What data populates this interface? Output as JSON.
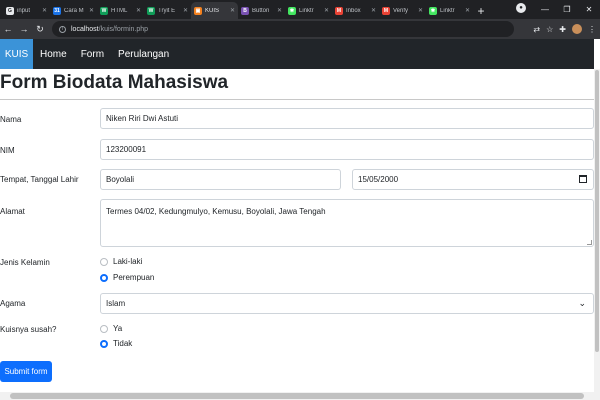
{
  "browser": {
    "tabs": [
      {
        "label": "input",
        "fav": "G",
        "color": "#e8eaed"
      },
      {
        "label": "Cara M",
        "fav": "31",
        "color": "#1a73e8"
      },
      {
        "label": "HTML",
        "fav": "W",
        "color": "#0f9d58"
      },
      {
        "label": "Tryit E",
        "fav": "W",
        "color": "#0f9d58"
      },
      {
        "label": "KUIS",
        "fav": "▣",
        "color": "#f4811f"
      },
      {
        "label": "Button",
        "fav": "B",
        "color": "#7952b3"
      },
      {
        "label": "Linktr",
        "fav": "✱",
        "color": "#43e660"
      },
      {
        "label": "Inbox",
        "fav": "M",
        "color": "#ea4335"
      },
      {
        "label": "Verify",
        "fav": "M",
        "color": "#ea4335"
      },
      {
        "label": "Linktr",
        "fav": "✱",
        "color": "#43e660"
      }
    ],
    "url_host": "localhost",
    "url_path": "/kuis/formin.php"
  },
  "navbar": {
    "brand": "KUIS",
    "links": [
      "Home",
      "Form",
      "Perulangan"
    ]
  },
  "form": {
    "title": "Form Biodata Mahasiswa",
    "nama_label": "Nama",
    "nama_value": "Niken Riri Dwi Astuti",
    "nim_label": "NIM",
    "nim_value": "123200091",
    "ttl_label": "Tempat, Tanggal Lahir",
    "tempat_value": "Boyolali",
    "tanggal_value": "15/05/2000",
    "alamat_label": "Alamat",
    "alamat_value": "Termes 04/02, Kedungmulyo, Kemusu, Boyolali, Jawa Tengah",
    "jk_label": "Jenis Kelamin",
    "jk_options": [
      "Laki-laki",
      "Perempuan"
    ],
    "jk_selected": "Perempuan",
    "agama_label": "Agama",
    "agama_value": "Islam",
    "kuis_label": "Kuisnya susah?",
    "kuis_options": [
      "Ya",
      "Tidak"
    ],
    "kuis_selected": "Tidak",
    "submit_label": "Submit form"
  }
}
